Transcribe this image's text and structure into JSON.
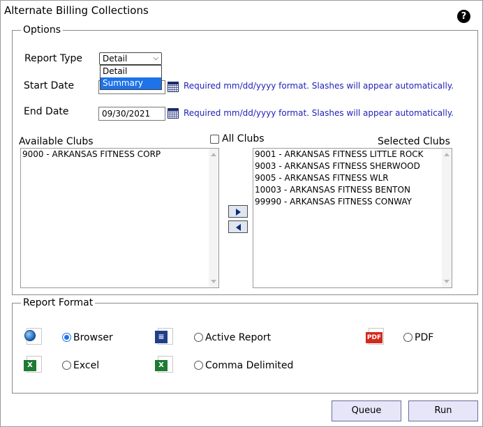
{
  "window": {
    "title": "Alternate Billing Collections"
  },
  "help": {
    "icon": "help-icon",
    "glyph": "?"
  },
  "options": {
    "legend": "Options",
    "report_type": {
      "label": "Report Type",
      "selected": "Detail",
      "options": [
        "Detail",
        "Summary"
      ],
      "highlighted": "Summary"
    },
    "start_date": {
      "label": "Start Date",
      "value": "",
      "hint": "Required mm/dd/yyyy format. Slashes will appear automatically."
    },
    "end_date": {
      "label": "End Date",
      "value": "09/30/2021",
      "hint": "Required mm/dd/yyyy format. Slashes will appear automatically."
    },
    "all_clubs_label": "All Clubs",
    "available": {
      "label": "Available Clubs",
      "items": [
        "9000 - ARKANSAS FITNESS CORP"
      ]
    },
    "selected": {
      "label": "Selected Clubs",
      "items": [
        "9001 - ARKANSAS FITNESS LITTLE ROCK",
        "9003 - ARKANSAS FITNESS SHERWOOD",
        "9005 - ARKANSAS FITNESS WLR",
        "10003 - ARKANSAS FITNESS BENTON",
        "99990 - ARKANSAS FITNESS CONWAY"
      ]
    }
  },
  "report_format": {
    "legend": "Report Format",
    "browser": {
      "label": "Browser",
      "icon": "globe-icon"
    },
    "active_report": {
      "label": "Active Report",
      "icon": "active-report-icon"
    },
    "pdf": {
      "label": "PDF",
      "icon": "pdf-icon",
      "badge": "PDF"
    },
    "excel": {
      "label": "Excel",
      "icon": "excel-icon"
    },
    "comma_delimited": {
      "label": "Comma Delimited",
      "icon": "csv-icon"
    },
    "selected": "Browser"
  },
  "buttons": {
    "queue": "Queue",
    "run": "Run"
  },
  "colors": {
    "hint": "#1f1fb8",
    "highlight": "#1e73e8",
    "excel": "#1f7a34",
    "pdf": "#d12b1e"
  }
}
